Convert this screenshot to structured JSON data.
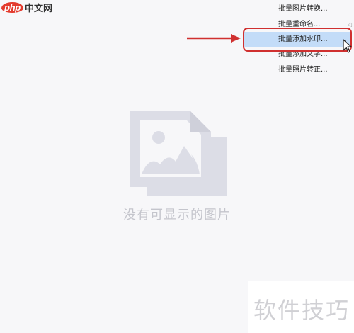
{
  "site_logo": {
    "prefix": "php",
    "suffix": "中文网"
  },
  "context_menu": {
    "items": [
      {
        "label": "批量图片转换..."
      },
      {
        "label": "批量重命名..."
      },
      {
        "label": "批量添加水印...",
        "selected": true
      },
      {
        "label": "批量添加文字..."
      },
      {
        "label": "批量照片转正..."
      }
    ]
  },
  "empty_state": {
    "text": "没有可显示的图片"
  },
  "watermark": {
    "text": "软件技巧"
  },
  "colors": {
    "annotation_red": "#d03030",
    "selected_bg": "#c3dcf8",
    "placeholder_icon": "#dcdde6"
  }
}
